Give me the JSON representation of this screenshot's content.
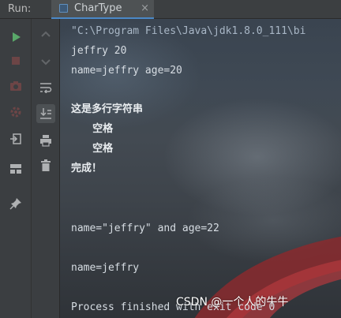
{
  "header": {
    "run_label": "Run:",
    "tab_title": "CharType",
    "tab_close": "×"
  },
  "console": {
    "lines": [
      "\"C:\\Program Files\\Java\\jdk1.8.0_111\\bi",
      "jeffry 20",
      "name=jeffry age=20",
      "这是多行字符串",
      "      空格",
      "      空格",
      "完成！",
      "name=\"jeffry\" and age=22",
      "name=jeffry",
      "Process finished with exit code 0"
    ]
  },
  "watermark": "CSDN @一个人的牛牛",
  "colors": {
    "accent": "#4a88c7",
    "run_green": "#59a869",
    "stop_red": "#c75450",
    "console_text": "#d7dde3"
  },
  "icons": {
    "toolbar1": [
      "run-icon",
      "stop-icon",
      "camera-icon",
      "settings-icon",
      "exit-icon",
      "layout-icon",
      "pin-icon"
    ],
    "toolbar2": [
      "up-arrow-icon",
      "down-arrow-icon",
      "soft-wrap-icon",
      "scroll-to-end-icon",
      "print-icon",
      "trash-icon"
    ]
  }
}
